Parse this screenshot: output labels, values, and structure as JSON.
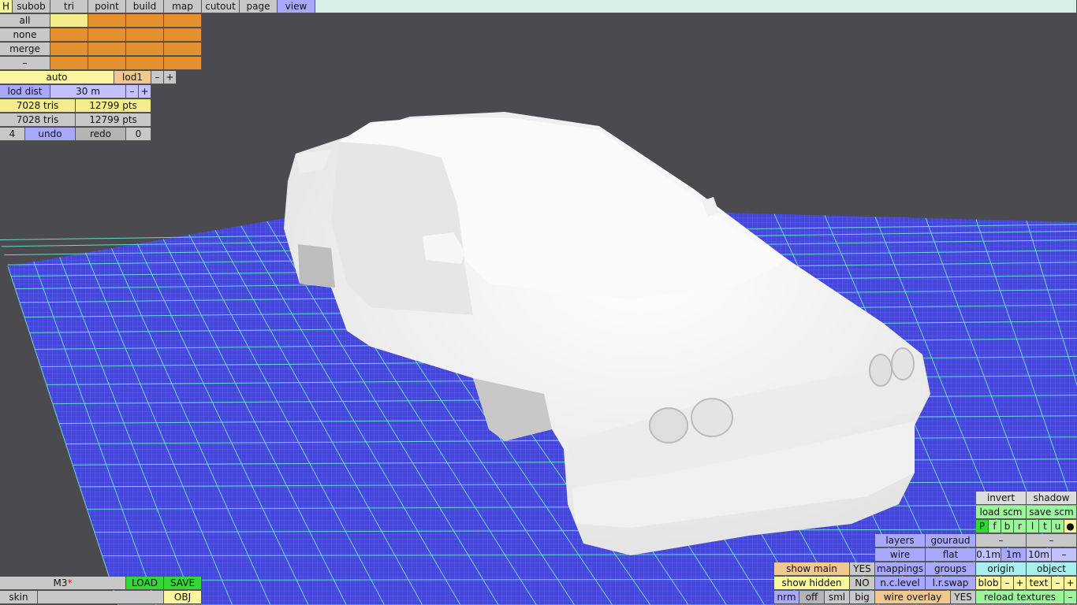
{
  "menu": {
    "items": [
      "H",
      "subob",
      "tri",
      "point",
      "build",
      "map",
      "cutout",
      "page",
      "view"
    ],
    "active": "view"
  },
  "select": {
    "rows": [
      "all",
      "none",
      "merge",
      "–"
    ]
  },
  "lod": {
    "mode": "auto",
    "level": "lod1",
    "minus": "–",
    "plus": "+",
    "dist_label": "lod dist",
    "dist_value": "30 m"
  },
  "stats": {
    "tris1": "7028 tris",
    "pts1": "12799 pts",
    "tris2": "7028 tris",
    "pts2": "12799 pts"
  },
  "history": {
    "count": "4",
    "undo": "undo",
    "redo": "redo",
    "redo_count": "0"
  },
  "file": {
    "name": "M3",
    "modified_mark": "*",
    "load": "LOAD",
    "save": "SAVE",
    "skin": "skin",
    "obj": "OBJ"
  },
  "view_options": {
    "invert": "invert",
    "shadow": "shadow",
    "load_scm": "load scm",
    "save_scm": "save scm",
    "flags": [
      "P",
      "f",
      "b",
      "r",
      "l",
      "t",
      "u",
      "●"
    ],
    "layers": "layers",
    "gouraud": "gouraud",
    "dash1": "–",
    "dash2": "–",
    "wire": "wire",
    "flat": "flat",
    "grid_01": "0.1m",
    "grid_1": "1m",
    "grid_10": "10m",
    "grid_minus": "–",
    "show_main": "show main",
    "show_main_val": "YES",
    "mappings": "mappings",
    "groups": "groups",
    "origin": "origin",
    "object": "object",
    "show_hidden": "show hidden",
    "show_hidden_val": "NO",
    "nc_level": "n.c.level",
    "lr_swap": "l.r.swap",
    "blob": "blob",
    "text": "text",
    "minus": "–",
    "plus": "+",
    "nrm": "nrm",
    "off": "off",
    "sml": "sml",
    "big": "big",
    "wire_overlay": "wire overlay",
    "wire_overlay_val": "YES",
    "reload_textures": "reload textures",
    "reload_minus": "–"
  },
  "colors": {
    "background": "#4a4a4f",
    "grid_floor": "#4a4adf",
    "grid_line": "#6ff0e0",
    "model": "#f4f4f4"
  }
}
